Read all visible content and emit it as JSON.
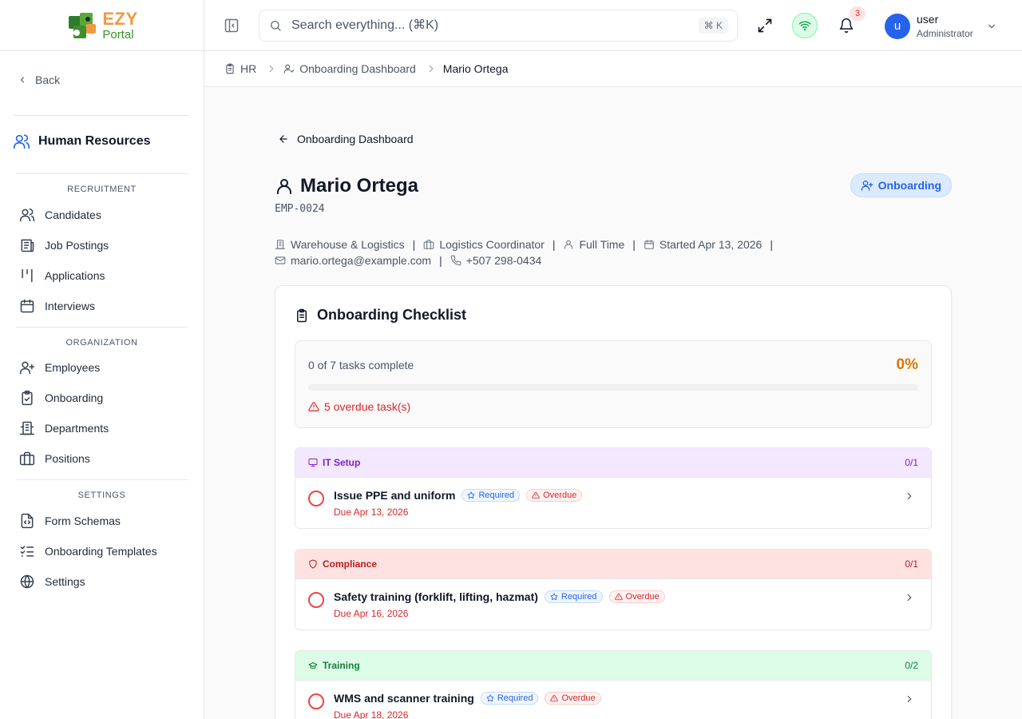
{
  "brand": {
    "name_top": "EZY",
    "name_bottom": "Portal"
  },
  "sidebar": {
    "back_label": "Back",
    "module_title": "Human Resources",
    "sections": [
      {
        "label": "RECRUITMENT",
        "items": [
          {
            "label": "Candidates",
            "icon": "users-icon"
          },
          {
            "label": "Job Postings",
            "icon": "newspaper-icon"
          },
          {
            "label": "Applications",
            "icon": "kanban-icon"
          },
          {
            "label": "Interviews",
            "icon": "calendar-icon"
          }
        ]
      },
      {
        "label": "ORGANIZATION",
        "items": [
          {
            "label": "Employees",
            "icon": "user-plus-icon"
          },
          {
            "label": "Onboarding",
            "icon": "clipboard-check-icon"
          },
          {
            "label": "Departments",
            "icon": "building-icon"
          },
          {
            "label": "Positions",
            "icon": "briefcase-icon"
          }
        ]
      },
      {
        "label": "SETTINGS",
        "items": [
          {
            "label": "Form Schemas",
            "icon": "file-code-icon"
          },
          {
            "label": "Onboarding Templates",
            "icon": "list-checks-icon"
          },
          {
            "label": "Settings",
            "icon": "globe-icon"
          }
        ]
      }
    ]
  },
  "topbar": {
    "search_placeholder": "Search everything... (⌘K)",
    "search_shortcut": "⌘ K",
    "notification_count": "3",
    "user": {
      "initial": "u",
      "name": "user",
      "role": "Administrator"
    }
  },
  "breadcrumb": {
    "items": [
      "HR",
      "Onboarding Dashboard",
      "Mario Ortega"
    ]
  },
  "employee": {
    "back_link": "Onboarding Dashboard",
    "name": "Mario Ortega",
    "id": "EMP-0024",
    "status": "Onboarding",
    "department": "Warehouse & Logistics",
    "position": "Logistics Coordinator",
    "employment_type": "Full Time",
    "start": "Started Apr 13, 2026",
    "email": "mario.ortega@example.com",
    "phone": "+507 298-0434"
  },
  "checklist": {
    "title": "Onboarding Checklist",
    "progress_text": "0 of 7 tasks complete",
    "progress_percent_label": "0%",
    "progress_fraction": 0,
    "overdue_text": "5 overdue task(s)",
    "groups": [
      {
        "name": "IT Setup",
        "count": "0/1",
        "icon": "monitor-icon",
        "bg": "#f3e8ff",
        "color": "#7e22ce",
        "tasks": [
          {
            "name": "Issue PPE and uniform",
            "required": "Required",
            "overdue": "Overdue",
            "due": "Due Apr 13, 2026"
          }
        ]
      },
      {
        "name": "Compliance",
        "count": "0/1",
        "icon": "shield-icon",
        "bg": "#fee2e2",
        "color": "#b91c1c",
        "tasks": [
          {
            "name": "Safety training (forklift, lifting, hazmat)",
            "required": "Required",
            "overdue": "Overdue",
            "due": "Due Apr 16, 2026"
          }
        ]
      },
      {
        "name": "Training",
        "count": "0/2",
        "icon": "graduation-cap-icon",
        "bg": "#dcfce7",
        "color": "#15803d",
        "tasks": [
          {
            "name": "WMS and scanner training",
            "required": "Required",
            "overdue": "Overdue",
            "due": "Due Apr 18, 2026"
          }
        ]
      }
    ]
  }
}
